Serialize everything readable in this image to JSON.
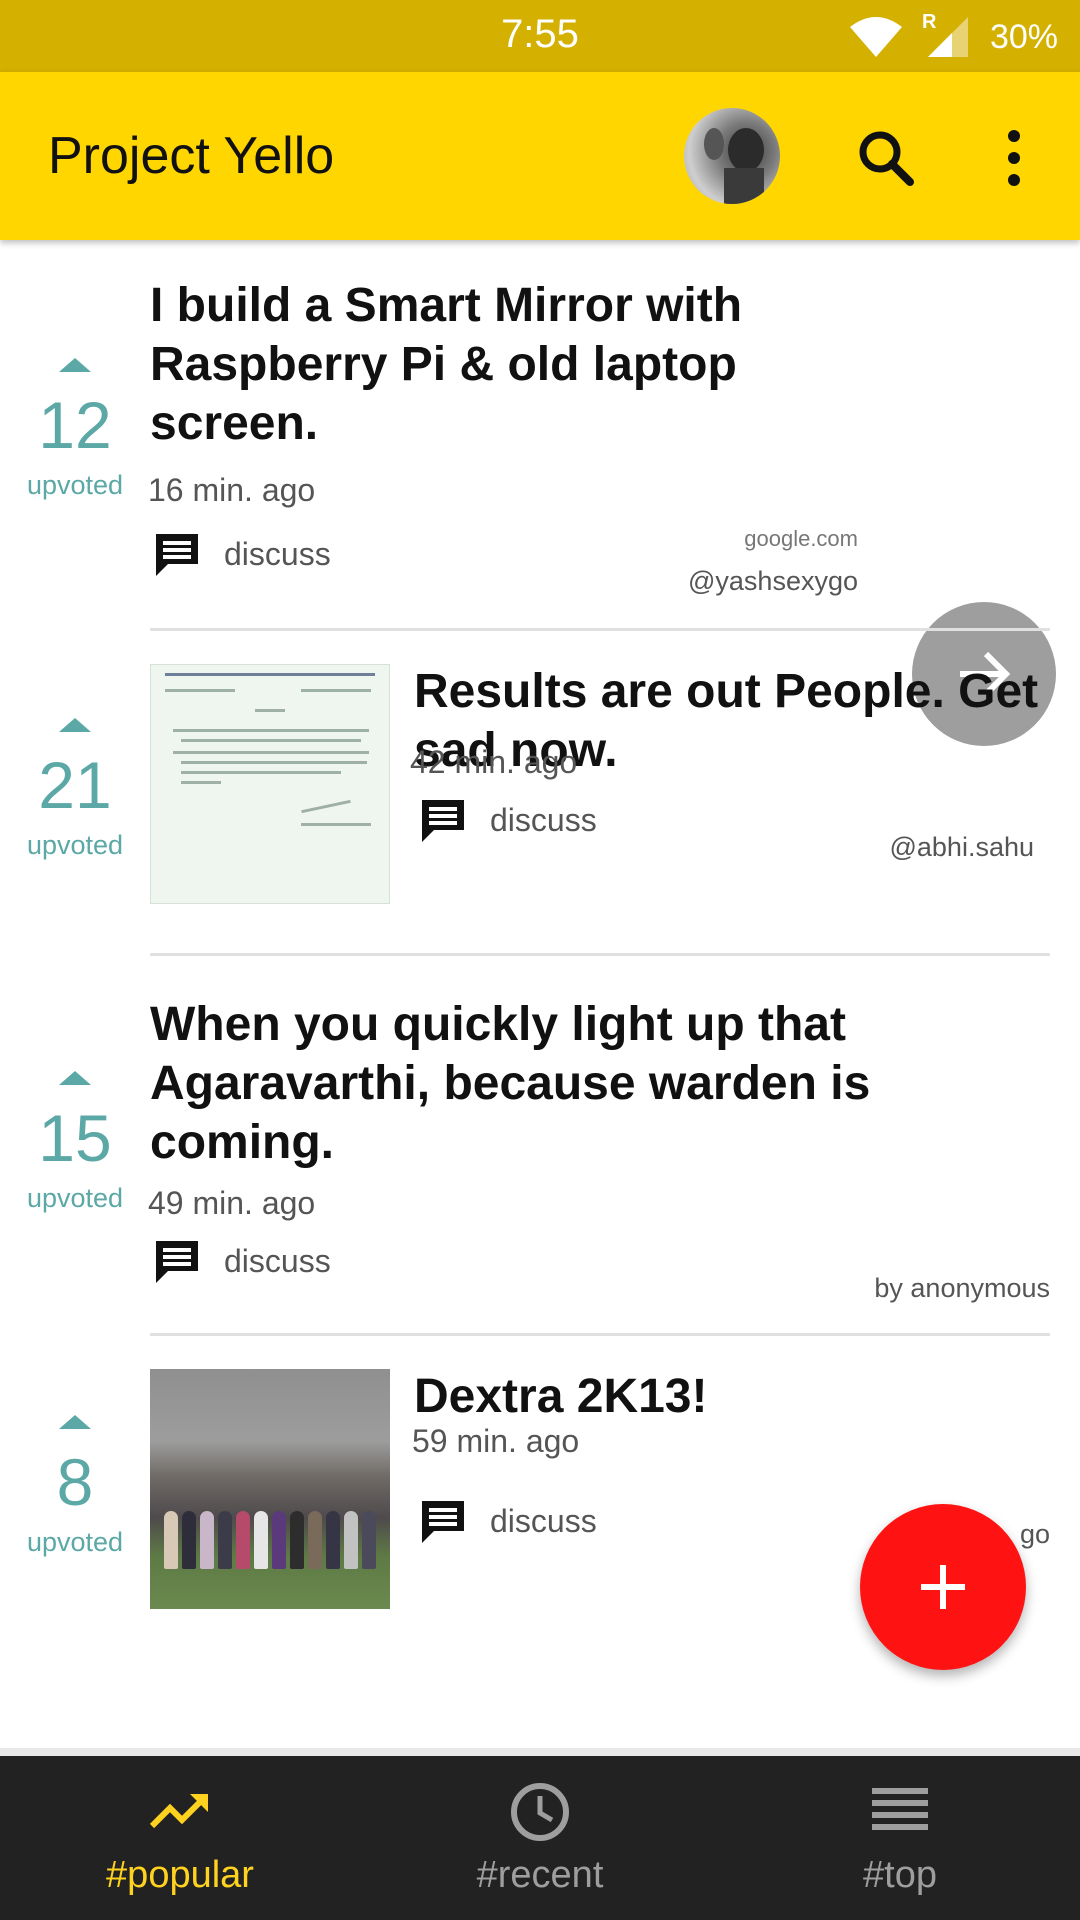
{
  "status_bar": {
    "time": "7:55",
    "network_label": "R",
    "battery": "30%"
  },
  "app_bar": {
    "title": "Project Yello",
    "avatar": "profile-photo",
    "search_icon": "search-icon",
    "more_icon": "more-vert-icon"
  },
  "colors": {
    "primary": "#ffd600",
    "status_bar": "#d4b000",
    "vote_teal": "#5ba8a6",
    "fab_red": "#ff1212",
    "nav_active": "#ffd21f",
    "nav_inactive": "#9e9e9e"
  },
  "posts": [
    {
      "votes": "12",
      "vote_label": "upvoted",
      "title": "I build a Smart Mirror with Raspberry Pi & old laptop screen.",
      "time": "16 min. ago",
      "discuss": "discuss",
      "source": "google.com",
      "author": "@yashsexygo"
    },
    {
      "votes": "21",
      "vote_label": "upvoted",
      "title": "Results are out People. Get sad now.",
      "time": "42 min. ago",
      "discuss": "discuss",
      "author": "@abhi.sahu"
    },
    {
      "votes": "15",
      "vote_label": "upvoted",
      "title": "When you quickly light up that Agaravarthi, because warden is coming.",
      "time": "49 min. ago",
      "discuss": "discuss",
      "author": "by anonymous"
    },
    {
      "votes": "8",
      "vote_label": "upvoted",
      "title": "Dextra 2K13!",
      "time": "59 min. ago",
      "discuss": "discuss",
      "author_partial": "go"
    }
  ],
  "bottom_nav": {
    "items": [
      {
        "label": "#popular",
        "icon": "trending-up-icon",
        "active": true
      },
      {
        "label": "#recent",
        "icon": "clock-icon",
        "active": false
      },
      {
        "label": "#top",
        "icon": "list-icon",
        "active": false
      }
    ]
  }
}
